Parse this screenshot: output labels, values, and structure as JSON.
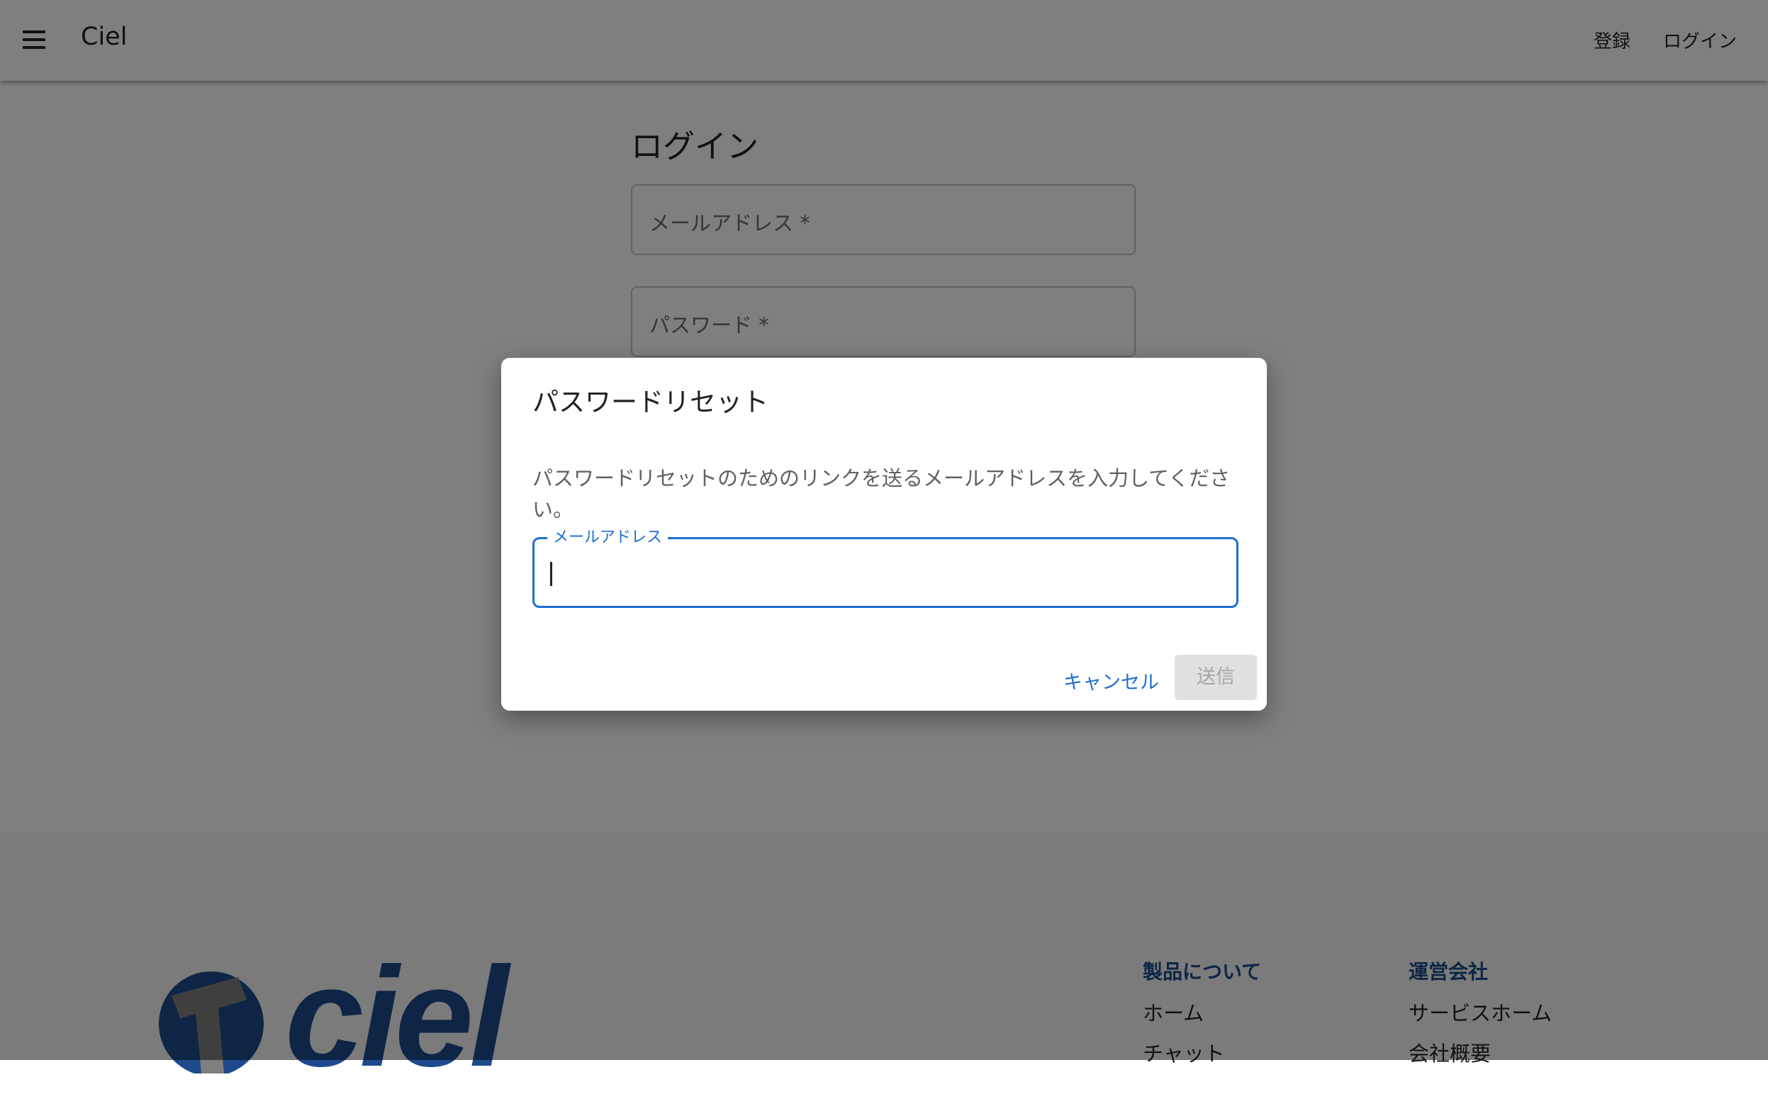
{
  "appbar": {
    "menu_icon": "hamburger-menu-icon",
    "brand": "Ciel",
    "nav": {
      "register": "登録",
      "login": "ログイン"
    }
  },
  "login": {
    "title": "ログイン",
    "email_label": "メールアドレス *",
    "password_label": "パスワード *"
  },
  "dialog": {
    "title": "パスワードリセット",
    "description": "パスワードリセットのためのリンクを送るメールアドレスを入力してください。",
    "email_field": {
      "label": "メールアドレス",
      "value": ""
    },
    "cancel_label": "キャンセル",
    "submit_label": "送信"
  },
  "footer": {
    "logo_text": "ciel",
    "columns": [
      {
        "heading": "製品について",
        "links": [
          "ホーム",
          "チャット"
        ]
      },
      {
        "heading": "運営会社",
        "links": [
          "サービスホーム",
          "会社概要"
        ]
      }
    ]
  },
  "colors": {
    "accent": "#1f6fd0",
    "brand_blue": "#1e4a8c",
    "disabled_bg": "#e0e0e0",
    "backdrop": "rgba(0,0,0,0.5)"
  }
}
